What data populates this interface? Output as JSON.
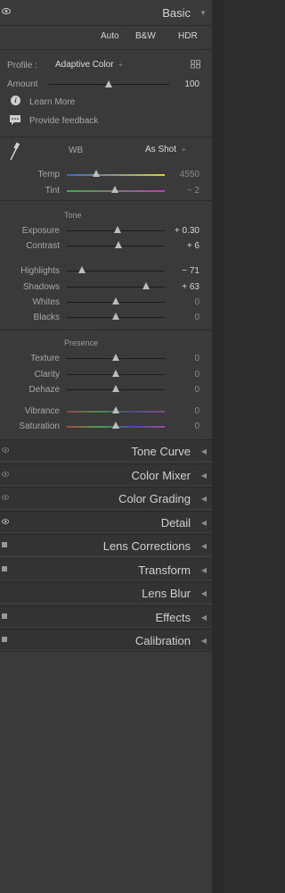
{
  "basic": {
    "title": "Basic",
    "buttons": {
      "auto": "Auto",
      "bw": "B&W",
      "hdr": "HDR"
    },
    "profile_label": "Profile :",
    "profile_value": "Adaptive Color",
    "profile_arrow": "÷",
    "amount_label": "Amount",
    "amount_value": "100",
    "learn_more": "Learn More",
    "feedback": "Provide feedback",
    "wb_label": "WB",
    "wb_value": "As Shot",
    "wb_arrow": "÷"
  },
  "wb_sliders": [
    {
      "label": "Temp",
      "value": "4550",
      "level": 0.3
    },
    {
      "label": "Tint",
      "value": "− 2",
      "level": 0.49
    }
  ],
  "tone": {
    "heading": "Tone",
    "sliders": [
      {
        "label": "Exposure",
        "value": "+ 0.30",
        "level": 0.52
      },
      {
        "label": "Contrast",
        "value": "+ 6",
        "level": 0.53
      },
      {
        "label": "Highlights",
        "value": "− 71",
        "level": 0.15
      },
      {
        "label": "Shadows",
        "value": "+ 63",
        "level": 0.81
      },
      {
        "label": "Whites",
        "value": "0",
        "level": 0.5
      },
      {
        "label": "Blacks",
        "value": "0",
        "level": 0.5
      }
    ]
  },
  "presence": {
    "heading": "Presence",
    "sliders": [
      {
        "label": "Texture",
        "value": "0",
        "level": 0.5
      },
      {
        "label": "Clarity",
        "value": "0",
        "level": 0.5
      },
      {
        "label": "Dehaze",
        "value": "0",
        "level": 0.5
      },
      {
        "label": "Vibrance",
        "value": "0",
        "level": 0.5
      },
      {
        "label": "Saturation",
        "value": "0",
        "level": 0.5
      }
    ]
  },
  "panels": [
    {
      "title": "Tone Curve",
      "icon": "eye-dim"
    },
    {
      "title": "Color Mixer",
      "icon": "eye-dim"
    },
    {
      "title": "Color Grading",
      "icon": "eye-dim"
    },
    {
      "title": "Detail",
      "icon": "eye-on"
    },
    {
      "title": "Lens Corrections",
      "icon": "switch"
    },
    {
      "title": "Transform",
      "icon": "switch"
    },
    {
      "title": "Lens Blur",
      "icon": "none"
    },
    {
      "title": "Effects",
      "icon": "switch"
    },
    {
      "title": "Calibration",
      "icon": "switch"
    }
  ],
  "icons": {
    "collapse": "triangle-left-icon",
    "expand": "triangle-down-icon"
  }
}
